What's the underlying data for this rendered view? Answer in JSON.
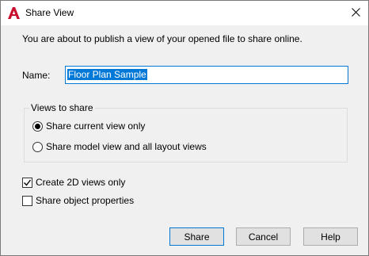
{
  "window": {
    "title": "Share View",
    "app_icon": "autocad-a-icon",
    "accent_color": "#0078d7"
  },
  "intro_text": "You are about to publish a view of your opened file to share online.",
  "name": {
    "label": "Name:",
    "value": "Floor Plan Sample"
  },
  "views_group": {
    "title": "Views to share",
    "options": [
      {
        "label": "Share current view only",
        "selected": true
      },
      {
        "label": "Share model view and all layout views",
        "selected": false
      }
    ]
  },
  "checkboxes": [
    {
      "label": "Create 2D views only",
      "checked": true
    },
    {
      "label": "Share object properties",
      "checked": false
    }
  ],
  "buttons": {
    "share": "Share",
    "cancel": "Cancel",
    "help": "Help"
  }
}
